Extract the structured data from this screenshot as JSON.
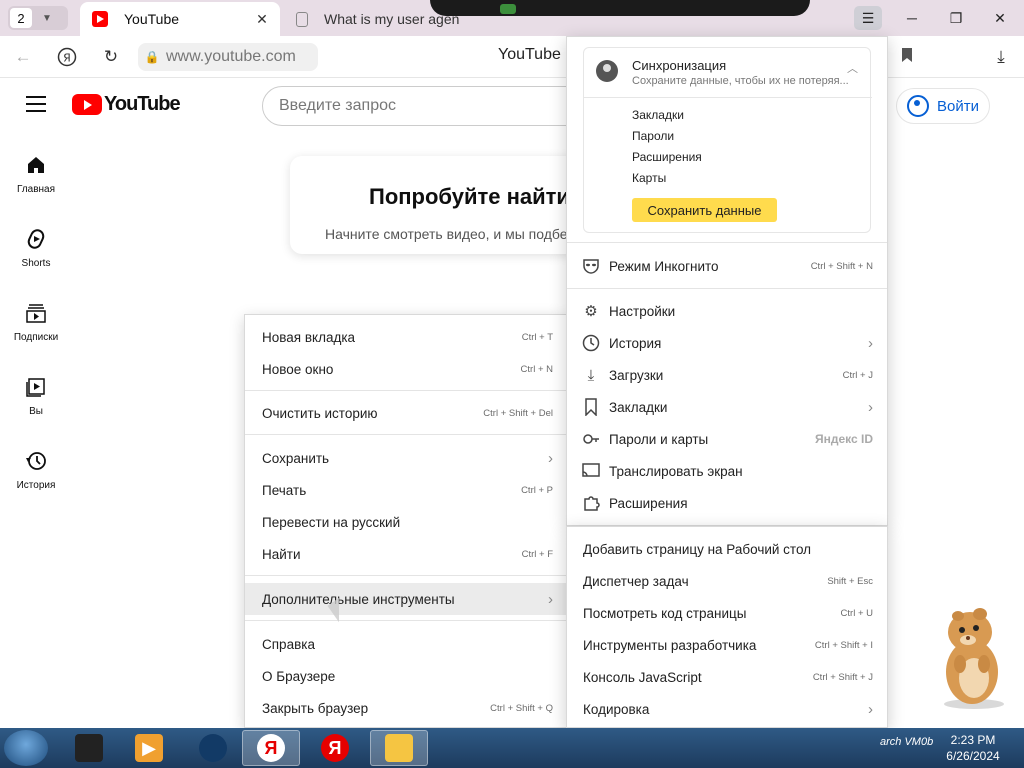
{
  "browser": {
    "tab_count": "2",
    "tabs": [
      {
        "title": "YouTube",
        "favicon": "youtube-icon"
      },
      {
        "title": "What is my user agen",
        "favicon": "document-icon"
      }
    ],
    "address": {
      "url": "www.youtube.com",
      "page_title": "YouTube"
    }
  },
  "youtube": {
    "logo_text": "YouTube",
    "search_placeholder": "Введите запрос",
    "signin_label": "Войти",
    "sidebar": [
      {
        "label": "Главная",
        "icon": "home-icon"
      },
      {
        "label": "Shorts",
        "icon": "shorts-icon"
      },
      {
        "label": "Подписки",
        "icon": "subscriptions-icon"
      },
      {
        "label": "Вы",
        "icon": "library-icon"
      },
      {
        "label": "История",
        "icon": "history-icon"
      }
    ],
    "promo": {
      "heading": "Попробуйте найти",
      "text": "Начните смотреть видео, и мы подбе"
    }
  },
  "context_menu": {
    "new_tab": {
      "label": "Новая вкладка",
      "shortcut": "Ctrl + T"
    },
    "new_window": {
      "label": "Новое окно",
      "shortcut": "Ctrl + N"
    },
    "clear_history": {
      "label": "Очистить историю",
      "shortcut": "Ctrl + Shift + Del"
    },
    "save": {
      "label": "Сохранить"
    },
    "print": {
      "label": "Печать",
      "shortcut": "Ctrl + P"
    },
    "translate": {
      "label": "Перевести на русский"
    },
    "find": {
      "label": "Найти",
      "shortcut": "Ctrl + F"
    },
    "more_tools": {
      "label": "Дополнительные инструменты"
    },
    "help": {
      "label": "Справка"
    },
    "about": {
      "label": "О Браузере"
    },
    "quit": {
      "label": "Закрыть браузер",
      "shortcut": "Ctrl + Shift + Q"
    }
  },
  "browser_menu": {
    "sync": {
      "title": "Синхронизация",
      "subtitle": "Сохраните данные, чтобы их не потеряя...",
      "items": [
        "Закладки",
        "Пароли",
        "Расширения",
        "Карты"
      ],
      "save_button": "Сохранить данные"
    },
    "incognito": {
      "label": "Режим Инкогнито",
      "shortcut": "Ctrl + Shift + N"
    },
    "settings": {
      "label": "Настройки"
    },
    "history": {
      "label": "История"
    },
    "downloads": {
      "label": "Загрузки",
      "shortcut": "Ctrl + J"
    },
    "bookmarks": {
      "label": "Закладки"
    },
    "passwords": {
      "label": "Пароли и карты",
      "badge": "Яндекс ID"
    },
    "cast": {
      "label": "Транслировать экран"
    },
    "extensions": {
      "label": "Расширения"
    }
  },
  "tools_submenu": {
    "add_desktop": {
      "label": "Добавить страницу на Рабочий стол"
    },
    "task_manager": {
      "label": "Диспетчер задач",
      "shortcut": "Shift + Esc"
    },
    "view_source": {
      "label": "Посмотреть код страницы",
      "shortcut": "Ctrl + U"
    },
    "devtools": {
      "label": "Инструменты разработчика",
      "shortcut": "Ctrl + Shift + I"
    },
    "js_console": {
      "label": "Консоль JavaScript",
      "shortcut": "Ctrl + Shift + J"
    },
    "encoding": {
      "label": "Кодировка"
    }
  },
  "taskbar": {
    "tray_label": "arch VM0b",
    "time": "2:23 PM",
    "date": "6/26/2024",
    "yandex_letter": "Я"
  },
  "colors": {
    "accent_yellow": "#ffdb4d",
    "youtube_red": "#ff0000",
    "link_blue": "#065fd4"
  }
}
